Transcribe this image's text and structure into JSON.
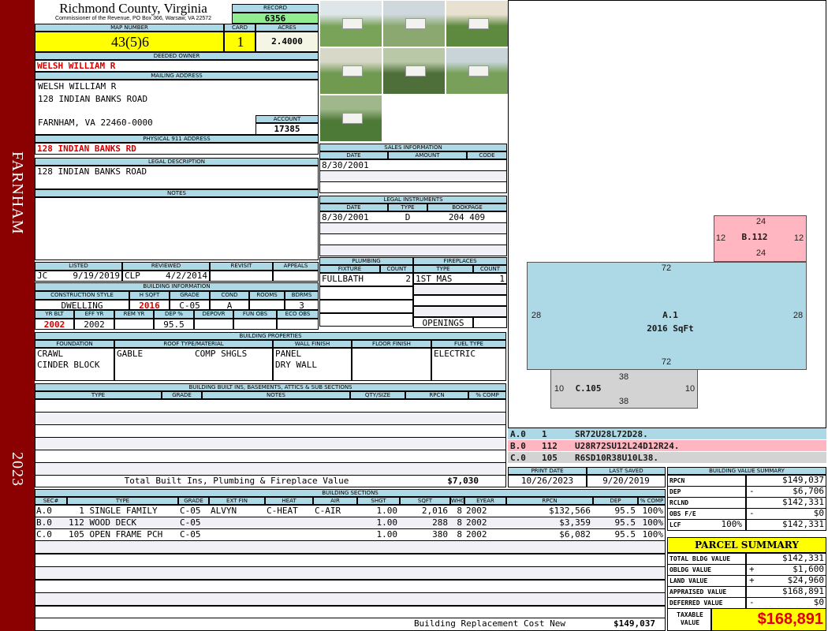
{
  "sidebar": {
    "town": "FARNHAM",
    "year": "2023"
  },
  "header": {
    "county": "Richmond County, Virginia",
    "subtitle": "Commissioner of the Revenue, PO Box 366, Warsaw, VA 22572",
    "record_label": "RECORD",
    "record": "6356"
  },
  "parcel": {
    "map_number_label": "MAP NUMBER",
    "map_number": "43(5)6",
    "card_label": "CARD",
    "card": "1",
    "acres_label": "ACRES",
    "acres": "2.4000"
  },
  "owner": {
    "label": "DEEDED OWNER",
    "name": "WELSH WILLIAM R"
  },
  "mailing": {
    "label": "MAILING ADDRESS",
    "lines": [
      "WELSH WILLIAM R",
      "128 INDIAN BANKS ROAD",
      "FARNHAM, VA 22460-0000"
    ]
  },
  "account": {
    "label": "ACCOUNT",
    "value": "17385"
  },
  "physical": {
    "label": "PHYSICAL 911 ADDRESS",
    "value": "128 INDIAN BANKS RD"
  },
  "legal": {
    "label": "LEGAL DESCRIPTION",
    "value": "128 INDIAN BANKS ROAD"
  },
  "notes": {
    "label": "NOTES"
  },
  "review": {
    "headers": [
      "LISTED",
      "REVIEWED",
      "REVISIT",
      "APPEALS"
    ],
    "listed_by": "JC",
    "listed_date": "9/19/2019",
    "reviewed_by": "CLP",
    "reviewed_date": "4/2/2014"
  },
  "building_info": {
    "label": "BUILDING INFORMATION",
    "headers1": [
      "CONSTRUCTION STYLE",
      "H SQFT",
      "GRADE",
      "COND",
      "ROOMS",
      "BDRMS"
    ],
    "values1": [
      "DWELLING",
      "2016",
      "C-05",
      "A",
      "",
      "3"
    ],
    "headers2": [
      "YR BLT",
      "EFF YR",
      "REM YR",
      "DEP %",
      "DEPOVR",
      "FUN OBS",
      "ECO OBS"
    ],
    "values2": [
      "2002",
      "2002",
      "",
      "95.5",
      "",
      "",
      ""
    ]
  },
  "properties": {
    "label": "BUILDING PROPERTIES",
    "headers": [
      "FOUNDATION",
      "ROOF TYPE/MATERIAL",
      "WALL FINISH",
      "FLOOR FINISH",
      "FUEL TYPE"
    ],
    "foundation": [
      "CRAWL",
      "CINDER BLOCK"
    ],
    "roof_type": "GABLE",
    "roof_material": "COMP SHGLS",
    "wall": [
      "PANEL",
      "DRY WALL"
    ],
    "fuel": "ELECTRIC"
  },
  "built_ins": {
    "label": "BUILDING BUILT INS, BASEMENTS, ATTICS & SUB SECTIONS",
    "headers": [
      "TYPE",
      "GRADE",
      "NOTES",
      "QTY/SIZE",
      "RPCN",
      "% COMP"
    ],
    "total_label": "Total Built Ins, Plumbing & Fireplace Value",
    "total": "$7,030"
  },
  "sales": {
    "label": "SALES INFORMATION",
    "headers": [
      "DATE",
      "AMOUNT",
      "CODE"
    ],
    "rows": [
      [
        "8/30/2001",
        "",
        ""
      ]
    ]
  },
  "instruments": {
    "label": "LEGAL INSTRUMENTS",
    "headers": [
      "DATE",
      "TYPE",
      "BOOKPAGE"
    ],
    "rows": [
      [
        "8/30/2001",
        "D",
        "204 409"
      ]
    ]
  },
  "plumbing": {
    "label": "PLUMBING",
    "headers": [
      "FIXTURE",
      "COUNT"
    ],
    "rows": [
      [
        "FULLBATH",
        "2"
      ]
    ]
  },
  "fireplaces": {
    "label": "FIREPLACES",
    "headers": [
      "TYPE",
      "COUNT"
    ],
    "rows": [
      [
        "1ST MAS",
        "1"
      ]
    ],
    "openings_label": "OPENINGS"
  },
  "sketch": {
    "a": {
      "label": "A.1",
      "area": "2016 SqFt",
      "top": "72",
      "bottom": "72",
      "left": "28",
      "right": "28",
      "color": "#add8e6"
    },
    "b": {
      "label": "B.112",
      "top": "24",
      "bottom": "24",
      "left": "12",
      "right": "12",
      "color": "#ffb6c1"
    },
    "c": {
      "label": "C.105",
      "top": "38",
      "bottom": "38",
      "left": "10",
      "right": "10",
      "color": "#d3d3d3"
    },
    "legend": [
      [
        "A.0",
        "1",
        "SR72U28L72D28."
      ],
      [
        "B.0",
        "112",
        "U28R72SU12L24D12R24."
      ],
      [
        "C.0",
        "105",
        "R6SD10R38U10L38."
      ]
    ]
  },
  "dates": {
    "print_label": "PRINT DATE",
    "print": "10/26/2023",
    "saved_label": "LAST SAVED",
    "saved": "9/20/2019"
  },
  "sections": {
    "label": "BUILDING SECTIONS",
    "headers": [
      "SEC#",
      "TYPE",
      "GRADE",
      "EXT FIN",
      "HEAT",
      "AIR",
      "SHGT",
      "SQFT",
      "WHGT",
      "EYEAR",
      "RPCN",
      "DEP",
      "% COMP"
    ],
    "rows": [
      [
        "A.0",
        "  1 SINGLE FAMILY",
        "C-05",
        "ALVYN",
        "C-HEAT",
        "C-AIR",
        "1.00",
        "2,016",
        "8",
        "2002",
        "$132,566",
        "95.5",
        "100%"
      ],
      [
        "B.0",
        "112 WOOD DECK",
        "C-05",
        "",
        "",
        "",
        "1.00",
        "288",
        "8",
        "2002",
        "$3,359",
        "95.5",
        "100%"
      ],
      [
        "C.0",
        "105 OPEN FRAME PCH",
        "C-05",
        "",
        "",
        "",
        "1.00",
        "380",
        "8",
        "2002",
        "$6,082",
        "95.5",
        "100%"
      ]
    ],
    "total_label": "Building Replacement Cost New",
    "total": "$149,037"
  },
  "value_summary": {
    "label": "BUILDING VALUE SUMMARY",
    "rows": [
      {
        "label": "RPCN",
        "pct": "",
        "sign": "",
        "value": "$149,037"
      },
      {
        "label": "DEP",
        "pct": "",
        "sign": "-",
        "value": "$6,706"
      },
      {
        "label": "RCLND",
        "pct": "",
        "sign": "",
        "value": "$142,331"
      },
      {
        "label": "OBS F/E",
        "pct": "",
        "sign": "-",
        "value": "$0"
      },
      {
        "label": "LCF",
        "pct": "100%",
        "sign": "",
        "value": "$142,331"
      }
    ]
  },
  "parcel_summary": {
    "label": "PARCEL SUMMARY",
    "rows": [
      {
        "label": "TOTAL BLDG VALUE",
        "sign": "",
        "value": "$142,331"
      },
      {
        "label": "OBLDG VALUE",
        "sign": "+",
        "value": "$1,600"
      },
      {
        "label": "LAND VALUE",
        "sign": "+",
        "value": "$24,960"
      },
      {
        "label": "APPRAISED VALUE",
        "sign": "",
        "value": "$168,891"
      },
      {
        "label": "DEFERRED VALUE",
        "sign": "-",
        "value": "$0"
      }
    ],
    "taxable_label": "TAXABLE VALUE",
    "taxable": "$168,891"
  },
  "colors": {
    "sidebar": "#8b0000",
    "header_band": "#add8e6",
    "highlight": "#ffff00",
    "record": "#90ee90",
    "alert_text": "#d40000"
  }
}
